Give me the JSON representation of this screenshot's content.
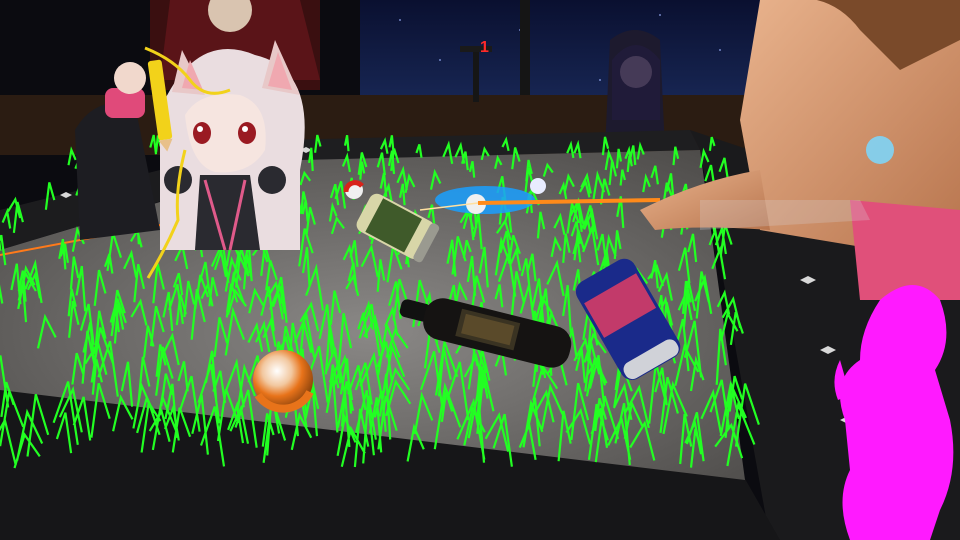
{
  "scene": {
    "description_label": "",
    "sign_text": "1",
    "can_text": "",
    "colors": {
      "grass": "#22ff22",
      "felt": "#6e6c6a",
      "rail": "#1c1c1e",
      "magenta_paint": "#ff1aff",
      "pencil": "#f2d21a",
      "orange_ball": "#e8731a",
      "cue_glow": "#ff8a1a",
      "sign_red": "#ff2a2a"
    },
    "objects": [
      {
        "name": "beer-bottle",
        "kind": "bottle"
      },
      {
        "name": "soda-can-blue",
        "kind": "can"
      },
      {
        "name": "soda-can-green",
        "kind": "can"
      },
      {
        "name": "orange-pool-ball",
        "kind": "ball"
      },
      {
        "name": "white-pool-ball",
        "kind": "ball"
      },
      {
        "name": "red-white-ball",
        "kind": "ball"
      },
      {
        "name": "pool-cue",
        "kind": "cue"
      }
    ]
  }
}
